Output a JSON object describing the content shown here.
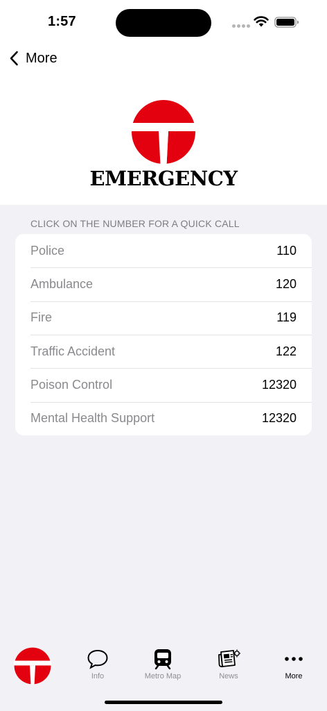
{
  "status_bar": {
    "time": "1:57"
  },
  "nav": {
    "back_label": "More"
  },
  "logo": {
    "title": "EMERGENCY"
  },
  "colors": {
    "brand_red": "#e3000f",
    "background": "#f2f1f6",
    "secondary_text": "#8a8a8e"
  },
  "section": {
    "header": "CLICK ON THE NUMBER FOR A QUICK CALL"
  },
  "contacts": [
    {
      "label": "Police",
      "number": "110"
    },
    {
      "label": "Ambulance",
      "number": "120"
    },
    {
      "label": "Fire",
      "number": "119"
    },
    {
      "label": "Traffic Accident",
      "number": "122"
    },
    {
      "label": "Poison Control",
      "number": "12320"
    },
    {
      "label": "Mental Health Support",
      "number": "12320"
    }
  ],
  "tab_bar": {
    "tabs": [
      {
        "icon": "logo-icon",
        "label": ""
      },
      {
        "icon": "chat-bubble-icon",
        "label": "Info"
      },
      {
        "icon": "tram-icon",
        "label": "Metro Map"
      },
      {
        "icon": "newspaper-icon",
        "label": "News"
      },
      {
        "icon": "ellipsis-icon",
        "label": "More"
      }
    ],
    "active": "More"
  }
}
